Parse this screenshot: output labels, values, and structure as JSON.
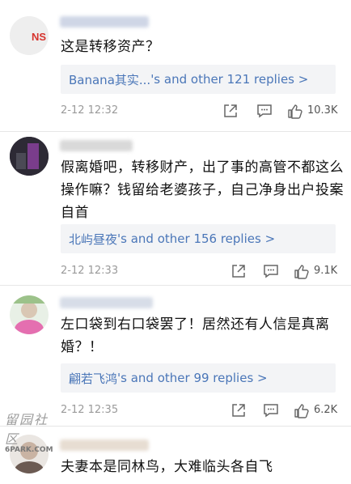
{
  "comments": [
    {
      "text": "这是转移资产？",
      "replies": {
        "name": "Banana其实...",
        "suffix": "'s and ",
        "count_text": "other 121 replies >"
      },
      "timestamp": "2-12 12:32",
      "likes": "10.3K"
    },
    {
      "text": "假离婚吧，转移财产，出了事的高管不都这么操作嘛？钱留给老婆孩子，自己净身出户投案自首",
      "replies": {
        "name": "北屿昼夜",
        "suffix": "'s and ",
        "count_text": "other 156 replies >"
      },
      "timestamp": "2-12 12:33",
      "likes": "9.1K"
    },
    {
      "text": "左口袋到右口袋罢了！居然还有人信是真离婚？！",
      "replies": {
        "name": "翩若飞鸿",
        "suffix": "'s and ",
        "count_text": "other 99 replies >"
      },
      "timestamp": "2-12 12:35",
      "likes": "6.2K"
    },
    {
      "text": "夫妻本是同林鸟，大难临头各自飞"
    }
  ],
  "avatar1_text": "NS",
  "watermark": {
    "line1": "留园社区",
    "line2": "6PARK.COM"
  },
  "icons": [
    "share-icon",
    "comment-icon",
    "thumbs-up-icon"
  ],
  "colors": {
    "link": "#4a76b8",
    "reply_bg": "#f3f4f6",
    "meta": "#9a9a9a"
  }
}
